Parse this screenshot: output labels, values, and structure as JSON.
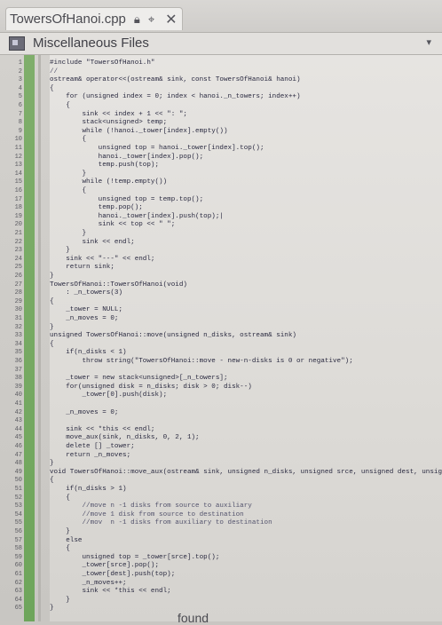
{
  "tab": {
    "title": "TowersOfHanoi.cpp",
    "lock_icon": "lock-icon",
    "pin_icon": "pin-icon",
    "close_icon": "close-icon"
  },
  "navigation": {
    "project_icon": "project-icon",
    "label": "Miscellaneous Files",
    "dropdown_icon": "chevron-down-icon"
  },
  "status": {
    "found": "found"
  },
  "editor": {
    "lines": [
      {
        "n": "1",
        "text": "#include \"TowersOfHanoi.h\""
      },
      {
        "n": "2",
        "text": "//"
      },
      {
        "n": "3",
        "text": "ostream& operator<<(ostream& sink, const TowersOfHanoi& hanoi)"
      },
      {
        "n": "4",
        "text": "{"
      },
      {
        "n": "5",
        "text": "    for (unsigned index = 0; index < hanoi._n_towers; index++)"
      },
      {
        "n": "6",
        "text": "    {"
      },
      {
        "n": "7",
        "text": "        sink << index + 1 << \": \";"
      },
      {
        "n": "8",
        "text": "        stack<unsigned> temp;"
      },
      {
        "n": "9",
        "text": "        while (!hanoi._tower[index].empty())"
      },
      {
        "n": "10",
        "text": "        {"
      },
      {
        "n": "11",
        "text": "            unsigned top = hanoi._tower[index].top();"
      },
      {
        "n": "12",
        "text": "            hanoi._tower[index].pop();"
      },
      {
        "n": "13",
        "text": "            temp.push(top);"
      },
      {
        "n": "14",
        "text": "        }"
      },
      {
        "n": "15",
        "text": "        while (!temp.empty())"
      },
      {
        "n": "16",
        "text": "        {"
      },
      {
        "n": "17",
        "text": "            unsigned top = temp.top();"
      },
      {
        "n": "18",
        "text": "            temp.pop();"
      },
      {
        "n": "19",
        "text": "            hanoi._tower[index].push(top);|"
      },
      {
        "n": "20",
        "text": "            sink << top << \" \";"
      },
      {
        "n": "21",
        "text": "        }"
      },
      {
        "n": "22",
        "text": "        sink << endl;"
      },
      {
        "n": "23",
        "text": "    }"
      },
      {
        "n": "24",
        "text": "    sink << \"---\" << endl;"
      },
      {
        "n": "25",
        "text": "    return sink;"
      },
      {
        "n": "26",
        "text": "}"
      },
      {
        "n": "27",
        "text": "TowersOfHanoi::TowersOfHanoi(void)"
      },
      {
        "n": "28",
        "text": "    : _n_towers(3)"
      },
      {
        "n": "29",
        "text": "{"
      },
      {
        "n": "30",
        "text": "    _tower = NULL;"
      },
      {
        "n": "31",
        "text": "    _n_moves = 0;"
      },
      {
        "n": "32",
        "text": "}"
      },
      {
        "n": "33",
        "text": "unsigned TowersOfHanoi::move(unsigned n_disks, ostream& sink)"
      },
      {
        "n": "34",
        "text": "{"
      },
      {
        "n": "35",
        "text": "    if(n_disks < 1)"
      },
      {
        "n": "36",
        "text": "        throw string(\"TowersOfHanoi::move - new-n-disks is 0 or negative\");"
      },
      {
        "n": "37",
        "text": ""
      },
      {
        "n": "38",
        "text": "    _tower = new stack<unsigned>[_n_towers];"
      },
      {
        "n": "39",
        "text": "    for(unsigned disk = n_disks; disk > 0; disk--)"
      },
      {
        "n": "40",
        "text": "        _tower[0].push(disk);"
      },
      {
        "n": "41",
        "text": ""
      },
      {
        "n": "42",
        "text": "    _n_moves = 0;"
      },
      {
        "n": "43",
        "text": ""
      },
      {
        "n": "44",
        "text": "    sink << *this << endl;"
      },
      {
        "n": "45",
        "text": "    move_aux(sink, n_disks, 0, 2, 1);"
      },
      {
        "n": "46",
        "text": "    delete [] _tower;"
      },
      {
        "n": "47",
        "text": "    return _n_moves;"
      },
      {
        "n": "48",
        "text": "}"
      },
      {
        "n": "49",
        "text": "void TowersOfHanoi::move_aux(ostream& sink, unsigned n_disks, unsigned srce, unsigned dest, unsigned aux)"
      },
      {
        "n": "50",
        "text": "{"
      },
      {
        "n": "51",
        "text": "    if(n_disks > 1)"
      },
      {
        "n": "52",
        "text": "    {"
      },
      {
        "n": "53",
        "text": "        //move n -1 disks from source to auxiliary"
      },
      {
        "n": "54",
        "text": "        //move 1 disk from source to destination"
      },
      {
        "n": "55",
        "text": "        //mov  n -1 disks from auxiliary to destination"
      },
      {
        "n": "56",
        "text": "    }"
      },
      {
        "n": "57",
        "text": "    else"
      },
      {
        "n": "58",
        "text": "    {"
      },
      {
        "n": "59",
        "text": "        unsigned top = _tower[srce].top();"
      },
      {
        "n": "60",
        "text": "        _tower[srce].pop();"
      },
      {
        "n": "61",
        "text": "        _tower[dest].push(top);"
      },
      {
        "n": "62",
        "text": "        _n_moves++;"
      },
      {
        "n": "63",
        "text": "        sink << *this << endl;"
      },
      {
        "n": "64",
        "text": "    }"
      },
      {
        "n": "65",
        "text": "}"
      }
    ]
  }
}
